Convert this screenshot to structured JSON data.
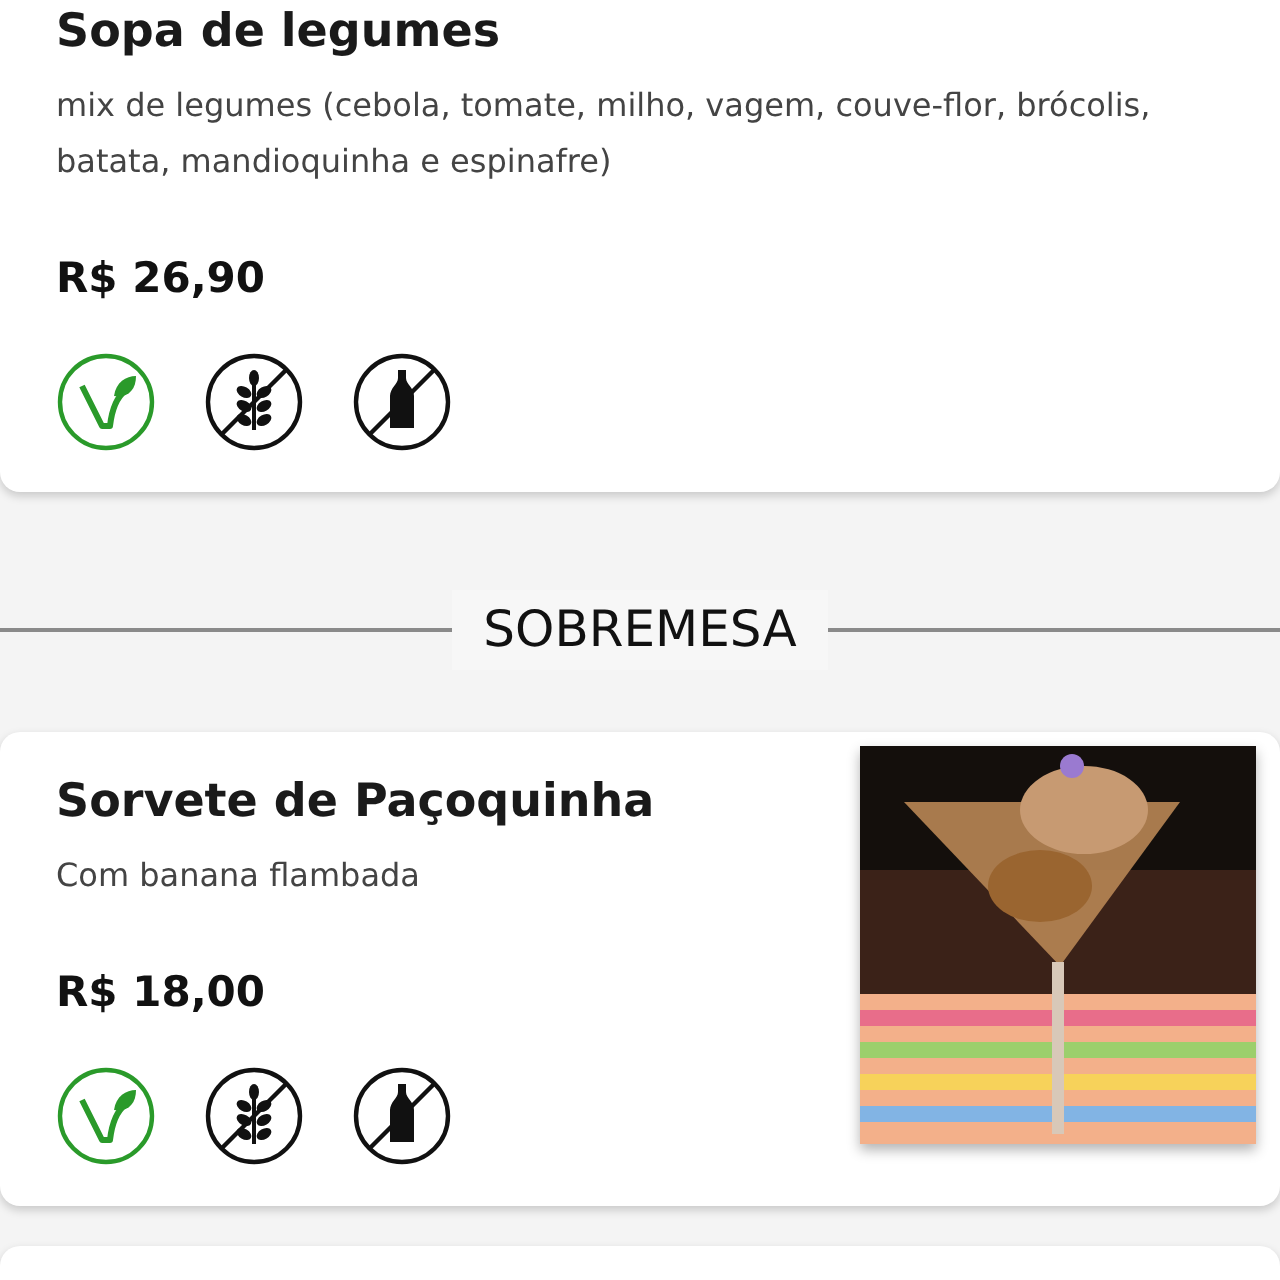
{
  "sections": [
    {
      "items": [
        {
          "name": "Sopa de legumes",
          "description": "mix de legumes (cebola, tomate, milho, vagem, couve-flor, brócolis, batata, mandioquinha e espinafre)",
          "price": "R$ 26,90",
          "badges": [
            {
              "kind": "vegan"
            },
            {
              "kind": "gluten_free"
            },
            {
              "kind": "lactose_free"
            }
          ]
        }
      ]
    },
    {
      "title": "SOBREMESA",
      "items": [
        {
          "name": "Sorvete de Paçoquinha",
          "description": "Com banana flambada",
          "price": "R$ 18,00",
          "badges": [
            {
              "kind": "vegan"
            },
            {
              "kind": "gluten_free"
            },
            {
              "kind": "lactose_free"
            }
          ]
        }
      ]
    }
  ]
}
